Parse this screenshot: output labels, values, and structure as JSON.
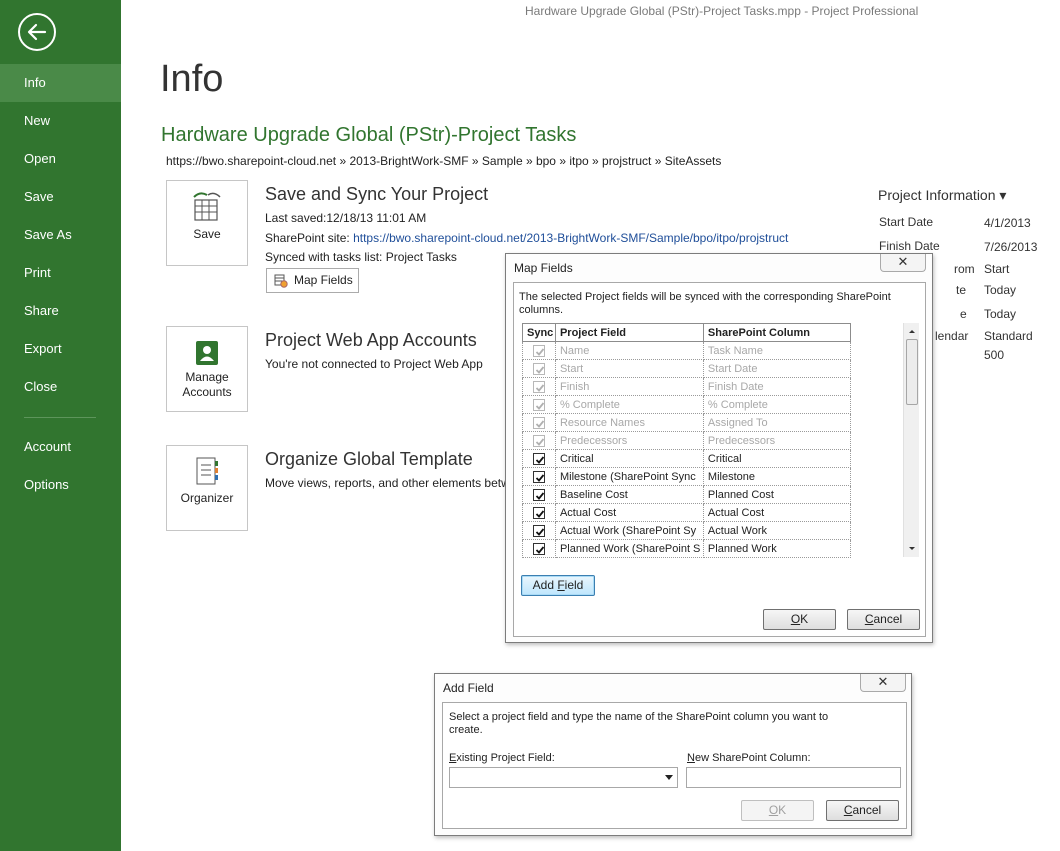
{
  "window": {
    "title": "Hardware Upgrade Global (PStr)-Project Tasks.mpp - Project Professional"
  },
  "nav": {
    "back_label": "Back",
    "items": [
      {
        "label": "Info"
      },
      {
        "label": "New"
      },
      {
        "label": "Open"
      },
      {
        "label": "Save"
      },
      {
        "label": "Save As"
      },
      {
        "label": "Print"
      },
      {
        "label": "Share"
      },
      {
        "label": "Export"
      },
      {
        "label": "Close"
      },
      {
        "label": "Account"
      },
      {
        "label": "Options"
      }
    ]
  },
  "page": {
    "title": "Info",
    "project_title": "Hardware Upgrade Global (PStr)-Project Tasks",
    "breadcrumb": "https://bwo.sharepoint-cloud.net » 2013-BrightWork-SMF » Sample » bpo » itpo » projstruct » SiteAssets"
  },
  "save_section": {
    "tile_label": "Save",
    "heading": "Save and Sync Your Project",
    "last_saved": "Last saved:12/18/13 11:01 AM",
    "site_prefix": "SharePoint site: ",
    "site_url": "https://bwo.sharepoint-cloud.net/2013-BrightWork-SMF/Sample/bpo/itpo/projstruct",
    "synced_text": "Synced with tasks list: Project Tasks",
    "map_fields_button": "Map Fields"
  },
  "pwa_section": {
    "tile_label_1": "Manage",
    "tile_label_2": "Accounts",
    "heading": "Project Web App Accounts",
    "text": "You're not connected to Project Web App"
  },
  "organize_section": {
    "tile_label": "Organizer",
    "heading": "Organize Global Template",
    "text": "Move views, reports, and other elements betw"
  },
  "project_info": {
    "title": "Project Information ▾",
    "rows": [
      {
        "label": "Start Date",
        "value": "4/1/2013"
      },
      {
        "label": "Finish Date",
        "value": "7/26/2013"
      },
      {
        "label": "rom",
        "value": "Start"
      },
      {
        "label": "te",
        "value": "Today"
      },
      {
        "label": "e",
        "value": "Today"
      },
      {
        "label": "lendar",
        "value": "Standard"
      },
      {
        "label": "",
        "value": "500"
      }
    ]
  },
  "map_fields_dialog": {
    "title": "Map Fields",
    "close": "✕",
    "description": "The selected Project fields will be synced with the corresponding SharePoint columns.",
    "columns": {
      "sync": "Sync",
      "project_field": "Project Field",
      "sharepoint_column": "SharePoint Column"
    },
    "rows": [
      {
        "checked": true,
        "disabled": true,
        "project_field": "Name",
        "sharepoint_column": "Task Name"
      },
      {
        "checked": true,
        "disabled": true,
        "project_field": "Start",
        "sharepoint_column": "Start Date"
      },
      {
        "checked": true,
        "disabled": true,
        "project_field": "Finish",
        "sharepoint_column": "Finish Date"
      },
      {
        "checked": true,
        "disabled": true,
        "project_field": "% Complete",
        "sharepoint_column": "% Complete"
      },
      {
        "checked": true,
        "disabled": true,
        "project_field": "Resource Names",
        "sharepoint_column": "Assigned To"
      },
      {
        "checked": true,
        "disabled": true,
        "project_field": "Predecessors",
        "sharepoint_column": "Predecessors"
      },
      {
        "checked": true,
        "disabled": false,
        "project_field": "Critical",
        "sharepoint_column": "Critical"
      },
      {
        "checked": true,
        "disabled": false,
        "project_field": "Milestone (SharePoint Sync",
        "sharepoint_column": "Milestone"
      },
      {
        "checked": true,
        "disabled": false,
        "project_field": "Baseline Cost",
        "sharepoint_column": "Planned Cost"
      },
      {
        "checked": true,
        "disabled": false,
        "project_field": "Actual Cost",
        "sharepoint_column": "Actual Cost"
      },
      {
        "checked": true,
        "disabled": false,
        "project_field": "Actual Work (SharePoint Sy",
        "sharepoint_column": "Actual Work"
      },
      {
        "checked": true,
        "disabled": false,
        "project_field": "Planned Work (SharePoint S",
        "sharepoint_column": "Planned Work"
      }
    ],
    "add_field_button": {
      "pre": "Add ",
      "accel": "F",
      "post": "ield"
    },
    "ok_button": {
      "accel": "O",
      "post": "K"
    },
    "cancel_button": {
      "accel": "C",
      "post": "ancel"
    }
  },
  "add_field_dialog": {
    "title": "Add Field",
    "close": "✕",
    "description": "Select a project field and type the name of the SharePoint column you want to create.",
    "existing_label": {
      "accel": "E",
      "post": "xisting Project Field:"
    },
    "existing_value": "",
    "new_label": {
      "accel": "N",
      "post": "ew SharePoint Column:"
    },
    "new_value": "",
    "ok_button": {
      "accel": "O",
      "post": "K"
    },
    "cancel_button": {
      "accel": "C",
      "post": "ancel"
    }
  },
  "colors": {
    "sidebar": "#31752f",
    "sidebar_active": "#4a8a48",
    "project_title": "#31752f",
    "link": "#1f4e99"
  }
}
